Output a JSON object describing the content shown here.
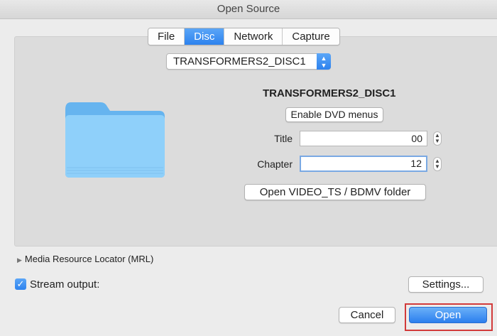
{
  "window": {
    "title": "Open Source"
  },
  "tabs": [
    {
      "label": "File",
      "active": false
    },
    {
      "label": "Disc",
      "active": true
    },
    {
      "label": "Network",
      "active": false
    },
    {
      "label": "Capture",
      "active": false
    }
  ],
  "disc": {
    "selected_device": "TRANSFORMERS2_DISC1",
    "name": "TRANSFORMERS2_DISC1",
    "enable_menus_label": "Enable DVD menus",
    "title_label": "Title",
    "title_value": "00",
    "chapter_label": "Chapter",
    "chapter_value": "12",
    "open_folder_label": "Open VIDEO_TS / BDMV folder"
  },
  "mrl": {
    "label": "Media Resource Locator (MRL)"
  },
  "stream": {
    "label": "Stream output:",
    "checked": true,
    "settings_label": "Settings..."
  },
  "buttons": {
    "cancel_label": "Cancel",
    "open_label": "Open"
  },
  "colors": {
    "accent": "#2d82ee",
    "highlight": "#d23a3a",
    "folder": "#7cc4f7"
  },
  "icons": {
    "folder": "folder-icon",
    "select_arrows": "updown-chevron-icon",
    "disclosure": "disclosure-triangle-icon",
    "check": "checkmark-icon"
  }
}
